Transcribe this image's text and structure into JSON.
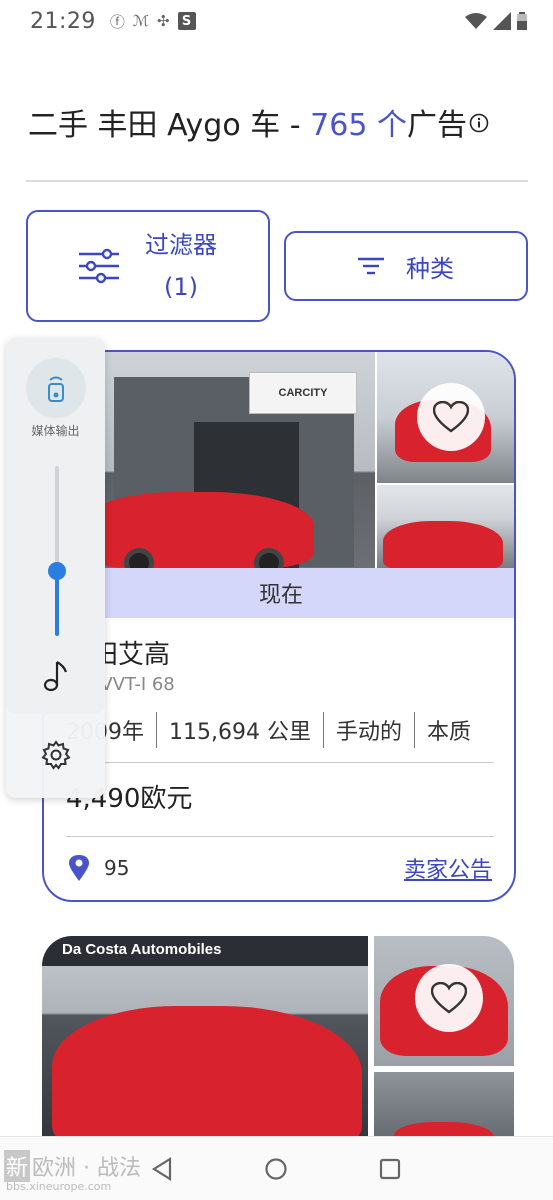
{
  "status_bar": {
    "time": "21:29",
    "left_icons": [
      "facebook-icon",
      "app-icon",
      "fan-icon",
      "s-icon"
    ],
    "s_badge": "S",
    "right_icons": [
      "wifi-icon",
      "signal-icon",
      "battery-icon"
    ]
  },
  "header": {
    "title_prefix": "二手 丰田 Aygo 车 - ",
    "count": "765 个",
    "title_suffix": "广告"
  },
  "buttons": {
    "filter_label": "过滤器",
    "filter_count": "(1)",
    "sort_label": "种类"
  },
  "listing1": {
    "sign_text": "CARCITY",
    "badge": "现在",
    "name": "丰田艾高",
    "variant": "1.0 VVT-I 68",
    "specs": [
      "2009年",
      "115,694 公里",
      "手动的",
      "本质"
    ],
    "price": "4,490欧元",
    "location": "95",
    "seller_link": "卖家公告"
  },
  "listing2": {
    "sign_text": "Da Costa Automobiles"
  },
  "media_panel": {
    "output_label": "媒体输出",
    "volume_level": 0.4
  },
  "watermark": {
    "badge": "新",
    "text": "欧洲 · 战法",
    "url": "bbs.xineurope.com"
  },
  "colors": {
    "accent": "#4a54c9",
    "badge_bg": "#d4d6fa",
    "volume_accent": "#2b7de0"
  }
}
